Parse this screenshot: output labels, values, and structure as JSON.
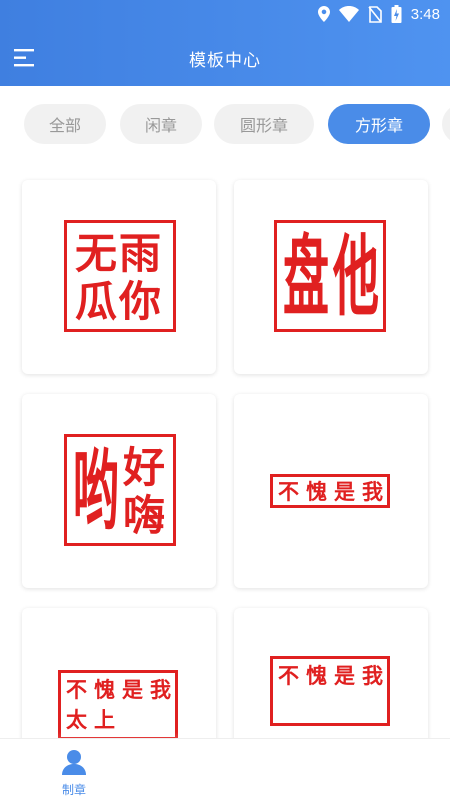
{
  "status_bar": {
    "time": "3:48",
    "icons": [
      "location-icon",
      "wifi-icon",
      "no-sim-icon",
      "battery-charging-icon"
    ]
  },
  "app_bar": {
    "title": "模板中心",
    "menu_icon": "menu-icon"
  },
  "tabs": [
    {
      "label": "全部",
      "active": false
    },
    {
      "label": "闲章",
      "active": false
    },
    {
      "label": "圆形章",
      "active": false
    },
    {
      "label": "方形章",
      "active": true
    }
  ],
  "templates": [
    {
      "name": "template-card-wugua",
      "chars": [
        "雨",
        "你",
        "无",
        "瓜"
      ]
    },
    {
      "name": "template-card-panta",
      "chars": [
        "他",
        "盘"
      ]
    },
    {
      "name": "template-card-youhao",
      "chars": [
        "好",
        "嗨",
        "哟"
      ]
    },
    {
      "name": "template-card-bukui-1",
      "chars": [
        "不",
        "愧",
        "是",
        "我"
      ]
    },
    {
      "name": "template-card-bukui-2",
      "chars": [
        "不",
        "愧",
        "是",
        "我",
        "太",
        "上"
      ]
    },
    {
      "name": "template-card-bukui-3",
      "chars": [
        "不",
        "愧",
        "是",
        "我"
      ]
    }
  ],
  "bottom_nav": {
    "label": "制章",
    "icon": "user-icon"
  },
  "colors": {
    "header_start": "#3f7fe0",
    "header_end": "#4f93f0",
    "tab_active": "#4a8ce8",
    "stamp_red": "#e02020"
  }
}
